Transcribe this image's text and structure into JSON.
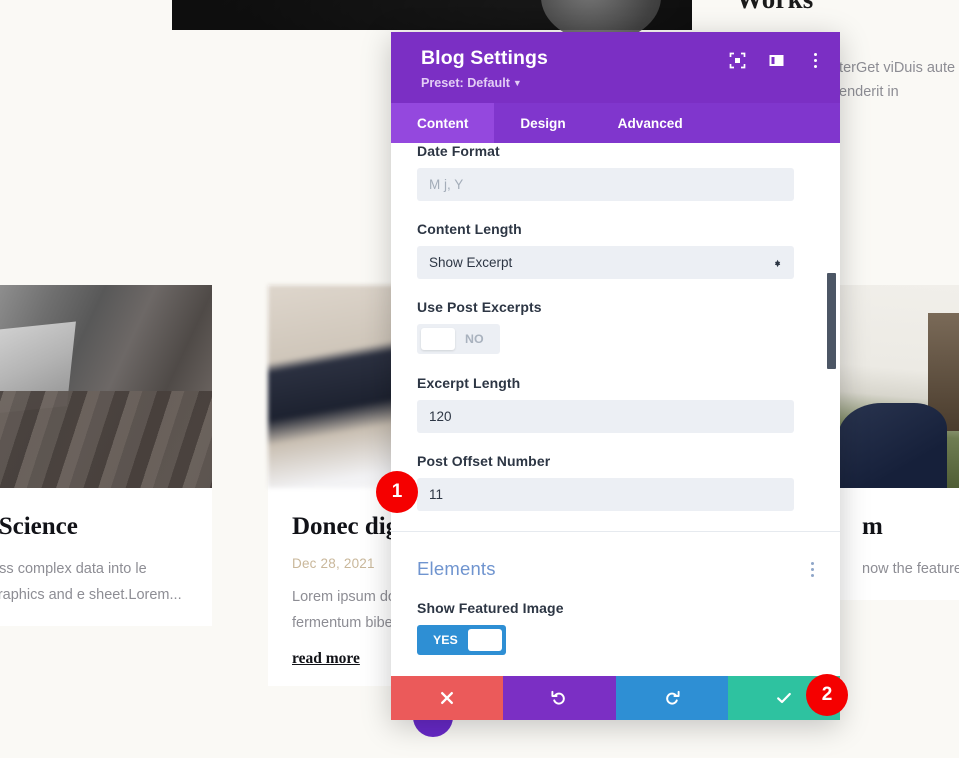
{
  "background": {
    "works_heading": "Works",
    "right_paragraph": "wsletterGet viDuis aute irure enderit in",
    "cards": [
      {
        "title": "of Data Science",
        "date": "",
        "excerpt": "nceWe process complex data into le information graphics and e sheet.Lorem...",
        "read_more": "",
        "image_name": "laptop-on-wooden-table-photo"
      },
      {
        "title": "Donec dig",
        "date": "Dec 28, 2021",
        "excerpt": "Lorem ipsum dolo adipiscing elit. Viv fermentum biben",
        "read_more": "read more",
        "image_name": "blurred-person-photo"
      },
      {
        "title": "m",
        "date": "",
        "excerpt": "now the featured . Lorem ipsum",
        "read_more": "",
        "image_name": "white-building-photo"
      }
    ]
  },
  "modal": {
    "title": "Blog Settings",
    "preset_label": "Preset: Default",
    "header_icons": [
      "expand-icon",
      "layout-panel-icon",
      "more-vertical-icon"
    ],
    "tabs": [
      {
        "label": "Content",
        "active": true
      },
      {
        "label": "Design",
        "active": false
      },
      {
        "label": "Advanced",
        "active": false
      }
    ],
    "fields": [
      {
        "label": "Date Format",
        "type": "text",
        "value": "",
        "placeholder": "M j, Y"
      },
      {
        "label": "Content Length",
        "type": "select",
        "value": "Show Excerpt"
      },
      {
        "label": "Use Post Excerpts",
        "type": "toggle",
        "value": "NO",
        "on": false
      },
      {
        "label": "Excerpt Length",
        "type": "text",
        "value": "120",
        "placeholder": ""
      },
      {
        "label": "Post Offset Number",
        "type": "text",
        "value": "11",
        "placeholder": ""
      }
    ],
    "elements_section": {
      "title": "Elements",
      "fields": [
        {
          "label": "Show Featured Image",
          "type": "toggle",
          "value": "YES",
          "on": true
        }
      ]
    },
    "actions": [
      {
        "name": "cancel",
        "icon": "close-icon",
        "color": "#eb5a5a"
      },
      {
        "name": "undo",
        "icon": "undo-icon",
        "color": "#7b2fc4"
      },
      {
        "name": "redo",
        "icon": "redo-icon",
        "color": "#2e8fd4"
      },
      {
        "name": "save",
        "icon": "check-icon",
        "color": "#2ec2a0"
      }
    ]
  },
  "annotations": [
    {
      "label": "1"
    },
    {
      "label": "2"
    }
  ],
  "colors": {
    "header_purple": "#7b2fc4",
    "tab_purple": "#8036cd",
    "tab_active": "#9448de",
    "toggle_on_blue": "#2e8fd4",
    "save_teal": "#2ec2a0",
    "cancel_red": "#eb5a5a",
    "badge_red": "#f50000",
    "section_blue": "#6f94cf",
    "page_cream": "#faf9f5"
  }
}
